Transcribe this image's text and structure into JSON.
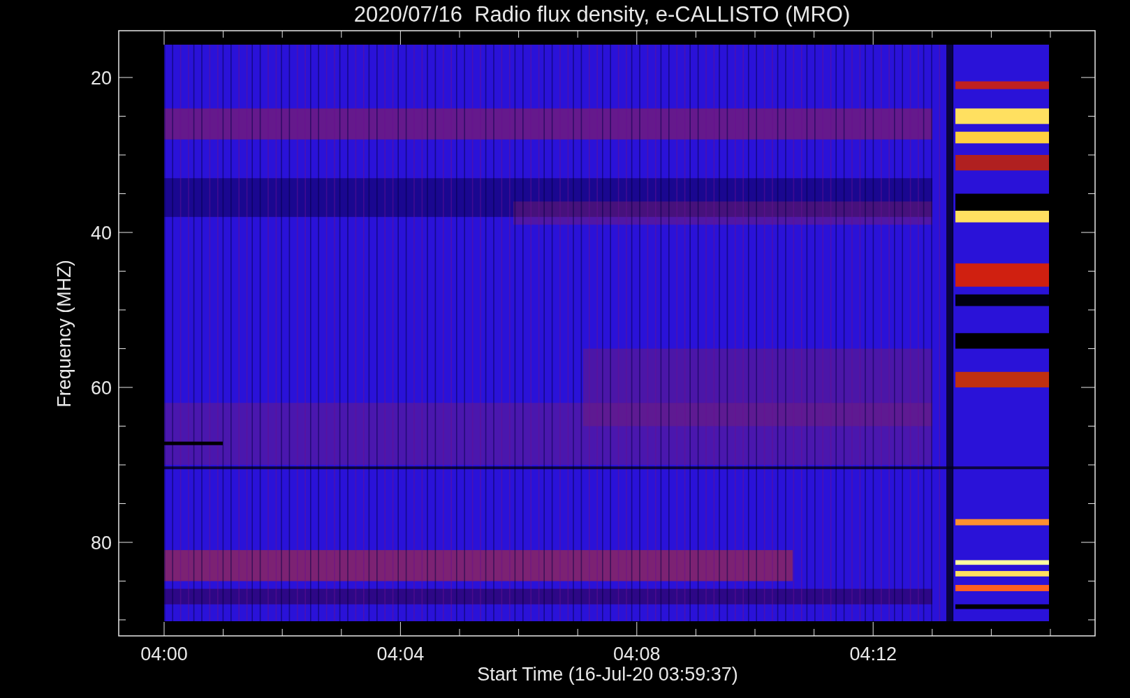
{
  "title": "2020/07/16  Radio flux density, e-CALLISTO (MRO)",
  "y_axis": {
    "label": "Frequency (MHZ)",
    "ticks": [
      "20",
      "40",
      "60",
      "80"
    ]
  },
  "x_axis": {
    "label": "Start Time (16-Jul-20 03:59:37)",
    "ticks": [
      "04:00",
      "04:04",
      "04:08",
      "04:12"
    ]
  }
}
